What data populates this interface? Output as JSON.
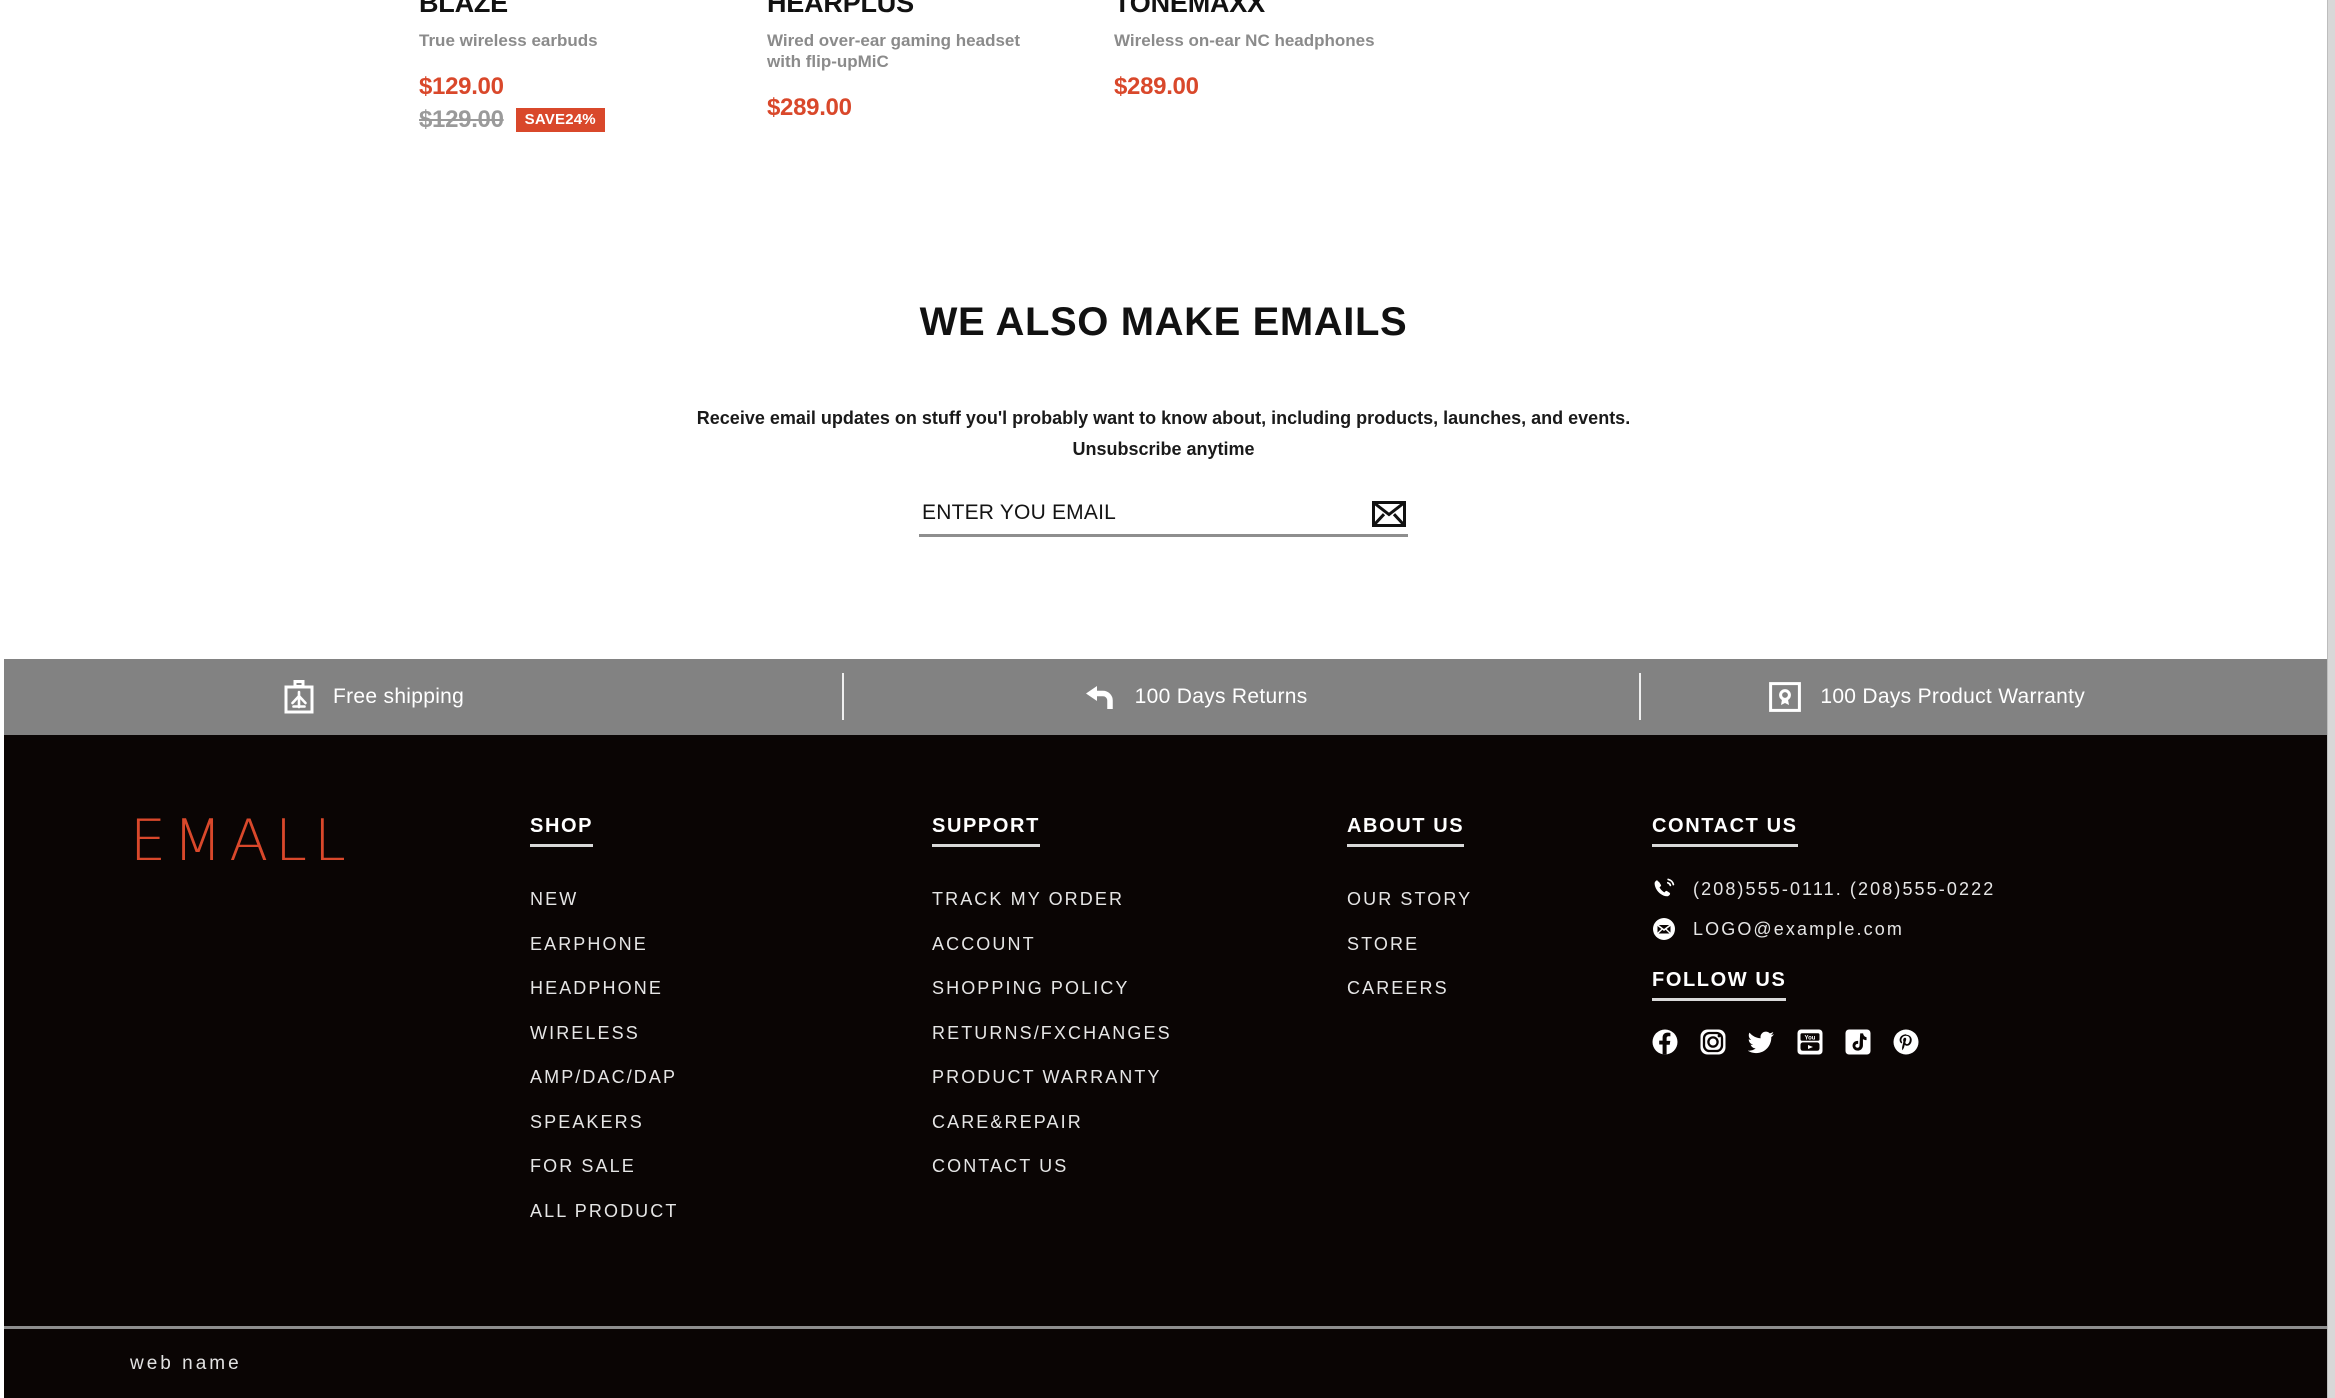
{
  "products": [
    {
      "name": "BLAZE",
      "desc": "True wireless earbuds",
      "price": "$129.00",
      "old_price": "$129.00",
      "badge": "SAVE24%"
    },
    {
      "name": "HEARPLUS",
      "desc": "Wired over-ear gaming headset with flip-upMiC",
      "price": "$289.00",
      "old_price": "",
      "badge": ""
    },
    {
      "name": "TONEMAXX",
      "desc": "Wireless on-ear NC headphones",
      "price": "$289.00",
      "old_price": "",
      "badge": ""
    }
  ],
  "newsletter": {
    "title": "WE ALSO MAKE EMAILS",
    "subtitle_line1": "Receive email updates on stuff you'l probably want to know about, including products, launches, and events.",
    "subtitle_line2": "Unsubscribe anytime",
    "input_placeholder": "ENTER YOU EMAIL",
    "input_value": "",
    "submit_icon": "envelope-icon"
  },
  "benefits": [
    {
      "icon": "shipping-briefcase-icon",
      "label": "Free shipping"
    },
    {
      "icon": "return-arrow-icon",
      "label": "100 Days Returns"
    },
    {
      "icon": "warranty-badge-icon",
      "label": "100 Days Product Warranty"
    }
  ],
  "footer": {
    "brand": "EMALL",
    "brand_color": "#d9482b",
    "background": "#0a0504",
    "columns": [
      {
        "title": "SHOP",
        "items": [
          "NEW",
          "EARPHONE",
          "HEADPHONE",
          "WIRELESS",
          "AMP/DAC/DAP",
          "SPEAKERS",
          "FOR SALE",
          "ALL PRODUCT"
        ]
      },
      {
        "title": "SUPPORT",
        "items": [
          "TRACK MY ORDER",
          "ACCOUNT",
          "SHOPPING POLICY",
          "RETURNS/FXCHANGES",
          "PRODUCT WARRANTY",
          "CARE&REPAIR",
          "CONTACT US"
        ]
      },
      {
        "title": "ABOUT US",
        "items": [
          "OUR STORY",
          "STORE",
          "CAREERS"
        ]
      }
    ],
    "contact": {
      "title": "CONTACT US",
      "phone": "(208)555-0111. (208)555-0222",
      "phone_icon": "phone-ring-icon",
      "email": "LOGO@example.com",
      "email_icon": "envelope-circle-icon"
    },
    "follow": {
      "title": "FOLLOW US",
      "socials": [
        "facebook-icon",
        "instagram-icon",
        "twitter-icon",
        "youtube-icon",
        "tiktok-icon",
        "pinterest-icon"
      ]
    },
    "bottom_text": "web name"
  },
  "colors": {
    "accent": "#d9482b",
    "benefit_bar": "#828282",
    "muted_text": "#8b8b8b"
  }
}
